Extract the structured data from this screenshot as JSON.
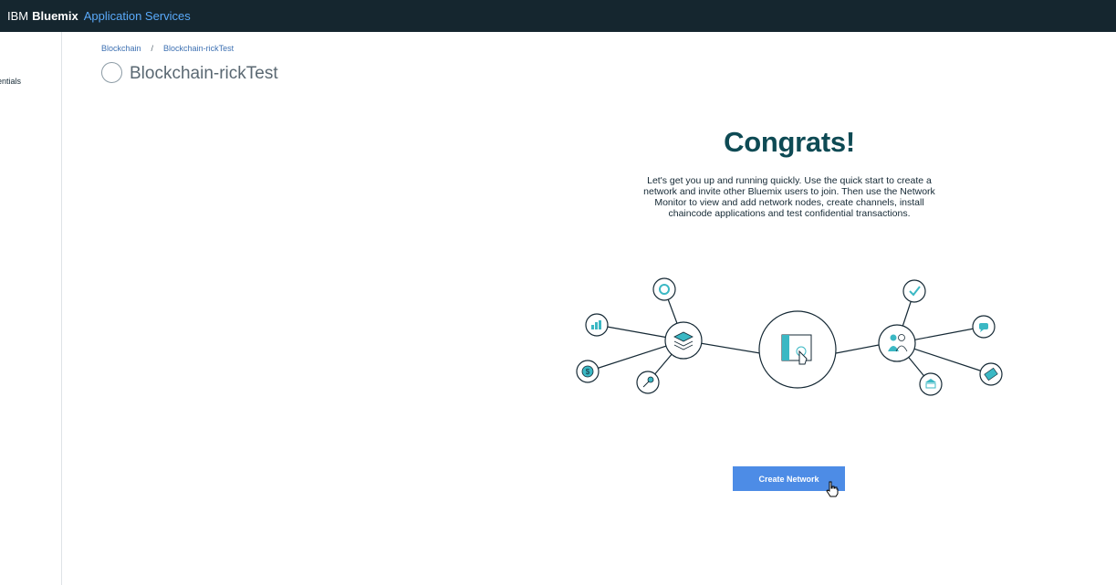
{
  "header": {
    "brand_ibm": "IBM",
    "brand_product": "Bluemix",
    "brand_section": "Application Services"
  },
  "sidebar": {
    "items": [
      {
        "label": "Service credentials"
      }
    ]
  },
  "breadcrumb": {
    "items": [
      "Blockchain",
      "Blockchain-rickTest"
    ],
    "separator": "/"
  },
  "page": {
    "title": "Blockchain-rickTest"
  },
  "welcome": {
    "heading": "Congrats!",
    "body": "Let's get you up and running quickly. Use the quick start to create a network and invite other Bluemix users to join. Then use the Network Monitor to view and add network nodes, create channels, install chaincode applications and test confidential transactions.",
    "illustration_icons": [
      "gear-icon",
      "bar-chart-icon",
      "dollar-icon",
      "key-icon",
      "layers-icon",
      "touch-screen-icon",
      "people-icon",
      "checkmark-icon",
      "chat-icon",
      "bank-icon",
      "ticket-icon"
    ]
  },
  "actions": {
    "create_network_label": "Create Network"
  },
  "colors": {
    "topbar": "#15262f",
    "accent": "#5aaafa",
    "heading": "#0e4a54",
    "button": "#4d8ce6",
    "icon_teal": "#3bb8c4"
  }
}
